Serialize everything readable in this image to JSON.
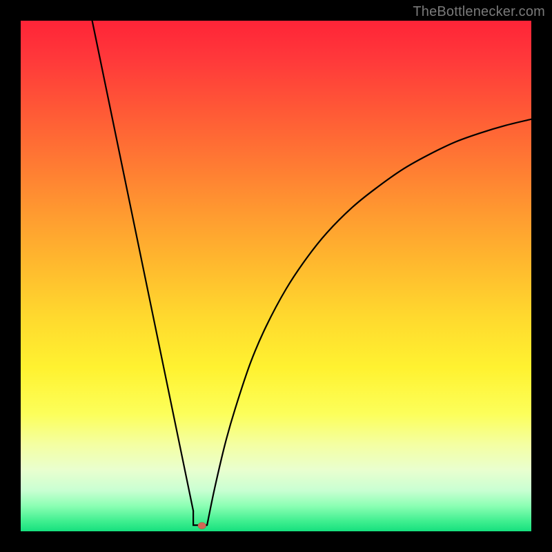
{
  "watermark": {
    "text": "TheBottlenecker.com"
  },
  "chart_data": {
    "type": "line",
    "title": "",
    "xlabel": "",
    "ylabel": "",
    "xlim": [
      0,
      100
    ],
    "ylim": [
      0,
      100
    ],
    "notch": {
      "x_pct": 33.8,
      "y_pct": 98.8
    },
    "dot": {
      "x_pct": 35.5,
      "y_pct": 98.9
    },
    "series": [
      {
        "name": "left-line",
        "x_pct": [
          14.0,
          33.8
        ],
        "y_pct": [
          0.0,
          96.0
        ]
      },
      {
        "name": "notch",
        "x_pct": [
          33.8,
          33.8,
          36.5
        ],
        "y_pct": [
          96.0,
          98.8,
          98.8
        ]
      },
      {
        "name": "right-curve",
        "x_pct": [
          36.5,
          38.0,
          40.0,
          42.0,
          45.0,
          48.0,
          52.0,
          56.0,
          60.0,
          65.0,
          70.0,
          75.0,
          80.0,
          85.0,
          90.0,
          95.0,
          100.0
        ],
        "y_pct": [
          98.8,
          91.5,
          83.0,
          76.0,
          67.0,
          60.0,
          52.5,
          46.5,
          41.5,
          36.5,
          32.5,
          29.0,
          26.2,
          23.8,
          22.0,
          20.5,
          19.3
        ]
      }
    ],
    "background_gradient": {
      "direction": "vertical",
      "stops": [
        {
          "pos": 0.0,
          "color": "#ff2438"
        },
        {
          "pos": 0.08,
          "color": "#ff3a3a"
        },
        {
          "pos": 0.18,
          "color": "#ff5a36"
        },
        {
          "pos": 0.28,
          "color": "#ff7a33"
        },
        {
          "pos": 0.38,
          "color": "#ff9b30"
        },
        {
          "pos": 0.48,
          "color": "#ffba2e"
        },
        {
          "pos": 0.58,
          "color": "#ffd92e"
        },
        {
          "pos": 0.68,
          "color": "#fff230"
        },
        {
          "pos": 0.77,
          "color": "#fcff5a"
        },
        {
          "pos": 0.83,
          "color": "#f4ffa2"
        },
        {
          "pos": 0.88,
          "color": "#e9ffcf"
        },
        {
          "pos": 0.92,
          "color": "#c9ffd2"
        },
        {
          "pos": 0.95,
          "color": "#8cffb4"
        },
        {
          "pos": 0.98,
          "color": "#40ef90"
        },
        {
          "pos": 1.0,
          "color": "#16e07e"
        }
      ]
    }
  }
}
